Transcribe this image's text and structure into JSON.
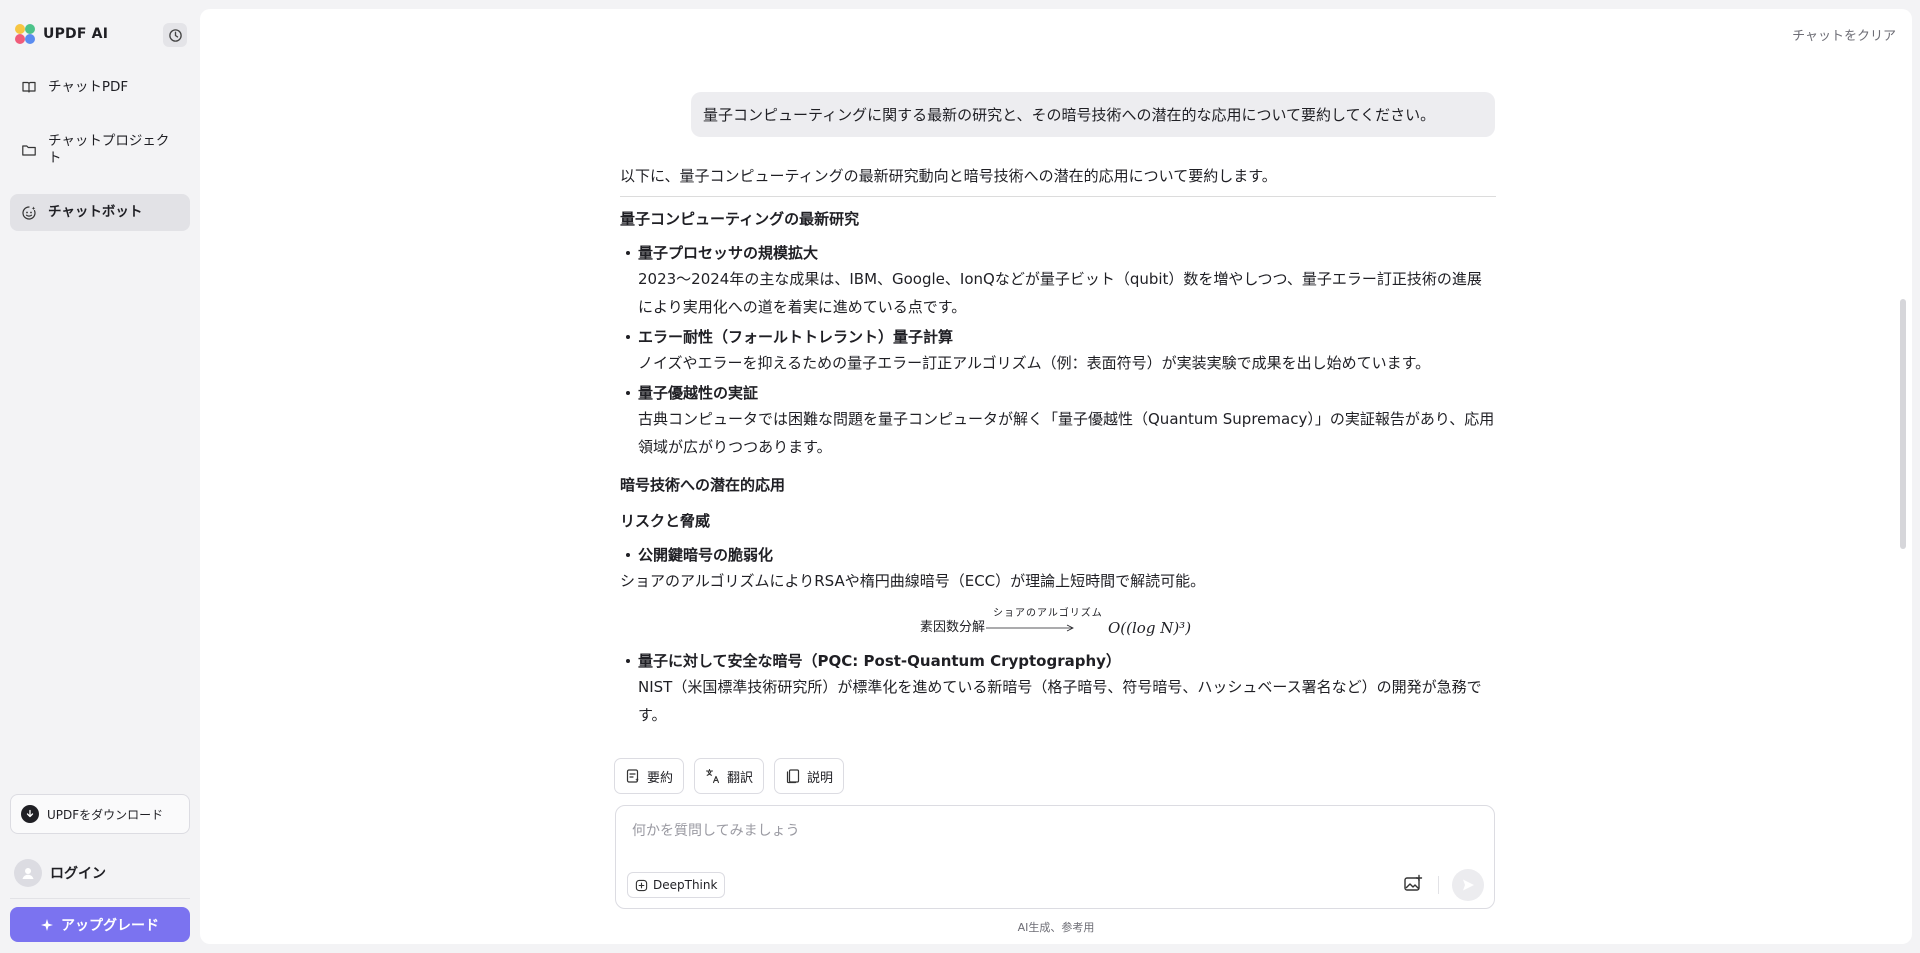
{
  "app": {
    "name": "UPDF AI"
  },
  "sidebar": {
    "items": [
      {
        "label": "チャットPDF",
        "icon": "book-icon"
      },
      {
        "label": "チャットプロジェクト",
        "icon": "folder-icon"
      },
      {
        "label": "チャットボット",
        "icon": "bot-icon"
      }
    ],
    "download_label": "UPDFをダウンロード",
    "login_label": "ログイン",
    "upgrade_label": "アップグレード"
  },
  "header": {
    "clear_chat_label": "チャットをクリア"
  },
  "chat": {
    "user_message": "量子コンピューティングに関する最新の研究と、その暗号技術への潜在的な応用について要約してください。",
    "answer": {
      "intro": "以下に、量子コンピューティングの最新研究動向と暗号技術への潜在的応用について要約します。",
      "section1_title": "量子コンピューティングの最新研究",
      "bullets1": [
        {
          "title": "量子プロセッサの規模拡大",
          "body": "2023～2024年の主な成果は、IBM、Google、IonQなどが量子ビット（qubit）数を増やしつつ、量子エラー訂正技術の進展により実用化への道を着実に進めている点です。"
        },
        {
          "title": "エラー耐性（フォールトトレラント）量子計算",
          "body": "ノイズやエラーを抑えるための量子エラー訂正アルゴリズム（例：表面符号）が実装実験で成果を出し始めています。"
        },
        {
          "title": "量子優越性の実証",
          "body": "古典コンピュータでは困難な問題を量子コンピュータが解く「量子優越性（Quantum Supremacy）」の実証報告があり、応用領域が広がりつつあります。"
        }
      ],
      "section2_title": "暗号技術への潜在的応用",
      "section3_title": "リスクと脅威",
      "bullet_risk_title": "公開鍵暗号の脆弱化",
      "bullet_risk_body": "ショアのアルゴリズムによりRSAや楕円曲線暗号（ECC）が理論上短時間で解読可能。",
      "formula": {
        "left": "素因数分解",
        "arrow_label": "ショアのアルゴリズム",
        "right": "O((log N)³)"
      },
      "bullet_pqc_title": "量子に対して安全な暗号（PQC: Post-Quantum Cryptography）",
      "bullet_pqc_body": "NIST（米国標準技術研究所）が標準化を進めている新暗号（格子暗号、符号暗号、ハッシュベース署名など）の開発が急務です。"
    }
  },
  "tools": [
    {
      "label": "要約",
      "icon": "summary-icon"
    },
    {
      "label": "翻訳",
      "icon": "translate-icon"
    },
    {
      "label": "説明",
      "icon": "explain-icon"
    }
  ],
  "composer": {
    "placeholder": "何かを質問してみましょう",
    "deepthink_label": "DeepThink"
  },
  "footer": {
    "disclaimer": "AI生成、参考用"
  },
  "colors": {
    "accent": "#7b73f0",
    "sidebar_bg": "#f3f3f5",
    "active_item": "#e2e2e6"
  }
}
